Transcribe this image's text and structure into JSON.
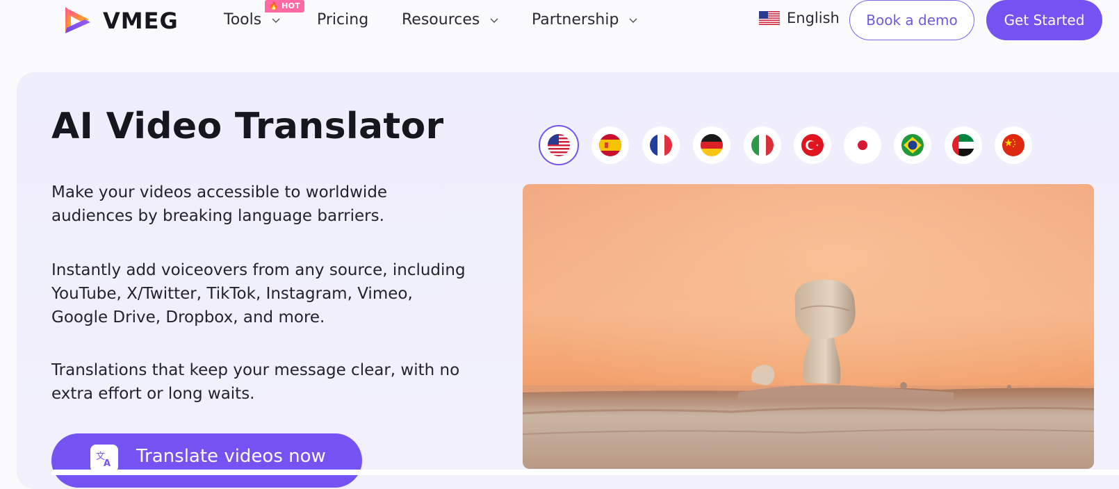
{
  "brand": {
    "name": "VMEG"
  },
  "nav": {
    "tools": "Tools",
    "hot_badge": "HOT",
    "pricing": "Pricing",
    "resources": "Resources",
    "partnership": "Partnership",
    "language": "English",
    "book_demo": "Book a demo",
    "get_started": "Get Started"
  },
  "hero": {
    "title": "AI Video Translator",
    "paragraphs": [
      "Make your videos accessible to worldwide audiences by breaking language barriers.",
      "Instantly add voiceovers from any source, including YouTube, X/Twitter, TikTok, Instagram, Vimeo, Google Drive, Dropbox, and more.",
      "Translations that keep your message clear, with no extra effort or long waits."
    ],
    "cta": "Translate videos now"
  },
  "flags": [
    {
      "icon": "us-flag-icon",
      "active": true
    },
    {
      "icon": "spain-flag-icon",
      "active": false
    },
    {
      "icon": "france-flag-icon",
      "active": false
    },
    {
      "icon": "germany-flag-icon",
      "active": false
    },
    {
      "icon": "italy-flag-icon",
      "active": false
    },
    {
      "icon": "turkey-flag-icon",
      "active": false
    },
    {
      "icon": "japan-flag-icon",
      "active": false
    },
    {
      "icon": "brazil-flag-icon",
      "active": false
    },
    {
      "icon": "uae-flag-icon",
      "active": false
    },
    {
      "icon": "china-flag-icon",
      "active": false
    }
  ],
  "colors": {
    "accent": "#7552f2",
    "hot_badge": "#ff6aa5",
    "hero_bg": "#efeefc"
  }
}
